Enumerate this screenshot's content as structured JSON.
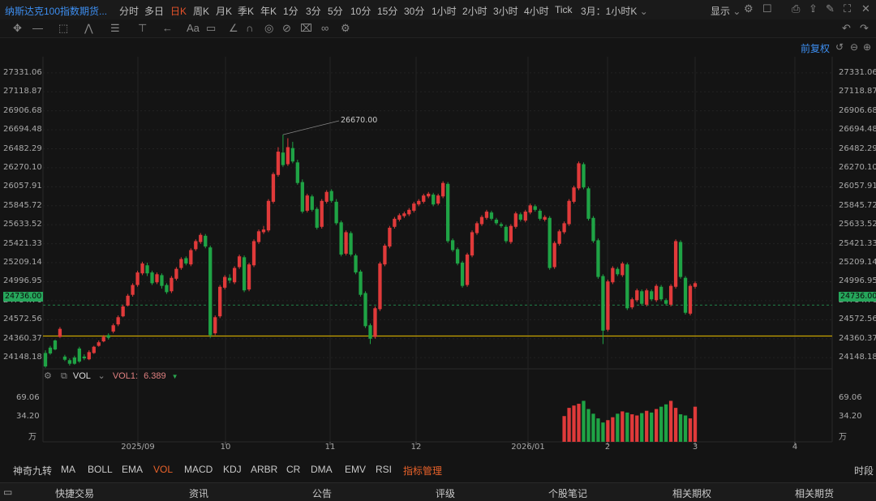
{
  "app": {
    "instrument_title": "纳斯达克100指数期货...",
    "timeframes": [
      "分时",
      "多日",
      "日K",
      "周K",
      "月K",
      "季K",
      "年K",
      "1分",
      "3分",
      "5分",
      "10分",
      "15分",
      "30分",
      "1小时",
      "2小时",
      "3小时",
      "4小时",
      "Tick"
    ],
    "active_timeframe": "日K",
    "contract_select": "3月：1小时K",
    "display_label": "显示",
    "adjust_label": "前复权"
  },
  "chart_data": {
    "type": "candlestick",
    "y_ticks": [
      "27331.06",
      "27118.87",
      "26906.68",
      "26694.48",
      "26482.29",
      "26270.10",
      "26057.91",
      "25845.72",
      "25633.52",
      "25421.33",
      "25209.14",
      "24996.95",
      "24784.76",
      "24572.56",
      "24360.37",
      "24148.18"
    ],
    "y_range": [
      24050,
      27420
    ],
    "x_ticks": [
      "2025/09",
      "10",
      "11",
      "12",
      "2026/01",
      "2",
      "3",
      "4"
    ],
    "current_price": "24736.00",
    "horizontal_line": 24390,
    "max_annotation": "26670.00",
    "candles": [
      [
        24200,
        24050,
        24230,
        24035
      ],
      [
        24260,
        24195,
        24280,
        24180
      ],
      [
        24340,
        24240,
        24350,
        24230
      ],
      [
        24380,
        24470,
        24490,
        24370
      ],
      [
        24160,
        24125,
        24180,
        24110
      ],
      [
        24120,
        24080,
        24140,
        24060
      ],
      [
        24150,
        24080,
        24170,
        24070
      ],
      [
        24250,
        24105,
        24270,
        24090
      ],
      [
        24160,
        24140,
        24185,
        24120
      ],
      [
        24130,
        24210,
        24230,
        24120
      ],
      [
        24200,
        24270,
        24280,
        24190
      ],
      [
        24280,
        24320,
        24340,
        24270
      ],
      [
        24330,
        24380,
        24400,
        24320
      ],
      [
        24400,
        24370,
        24420,
        24350
      ],
      [
        24440,
        24510,
        24530,
        24420
      ],
      [
        24520,
        24600,
        24620,
        24500
      ],
      [
        24610,
        24720,
        24740,
        24600
      ],
      [
        24730,
        24840,
        24860,
        24720
      ],
      [
        24850,
        24960,
        24980,
        24830
      ],
      [
        24960,
        25100,
        25120,
        24940
      ],
      [
        25090,
        25200,
        25220,
        25070
      ],
      [
        25180,
        25090,
        25210,
        25060
      ],
      [
        25100,
        24980,
        25120,
        24960
      ],
      [
        24990,
        25080,
        25100,
        24970
      ],
      [
        25070,
        24950,
        25090,
        24920
      ],
      [
        24960,
        24880,
        24980,
        24860
      ],
      [
        24890,
        25040,
        25060,
        24870
      ],
      [
        25030,
        25140,
        25160,
        25010
      ],
      [
        25150,
        25250,
        25270,
        25130
      ],
      [
        25260,
        25200,
        25280,
        25180
      ],
      [
        25190,
        25350,
        25370,
        25170
      ],
      [
        25360,
        25450,
        25470,
        25340
      ],
      [
        25440,
        25520,
        25540,
        25420
      ],
      [
        25510,
        25390,
        25530,
        25370
      ],
      [
        25380,
        24400,
        25400,
        24370
      ],
      [
        24420,
        24600,
        24620,
        24400
      ],
      [
        24610,
        24940,
        24960,
        24590
      ],
      [
        24930,
        25050,
        25070,
        24910
      ],
      [
        25040,
        25010,
        25080,
        24980
      ],
      [
        24990,
        25150,
        25170,
        24970
      ],
      [
        25160,
        25280,
        25300,
        25140
      ],
      [
        25270,
        24900,
        25290,
        24880
      ],
      [
        24910,
        25190,
        25210,
        24890
      ],
      [
        25180,
        25450,
        25470,
        25160
      ],
      [
        25440,
        25560,
        25580,
        25420
      ],
      [
        25550,
        25580,
        25620,
        25530
      ],
      [
        25570,
        25900,
        25920,
        25550
      ],
      [
        25890,
        26200,
        26220,
        25870
      ],
      [
        26190,
        26450,
        26500,
        26170
      ],
      [
        26440,
        26300,
        26640,
        26280
      ],
      [
        26310,
        26500,
        26600,
        26290
      ],
      [
        26490,
        26340,
        26560,
        26320
      ],
      [
        26330,
        26100,
        26360,
        26080
      ],
      [
        26110,
        25780,
        26140,
        25760
      ],
      [
        25790,
        25960,
        25980,
        25770
      ],
      [
        25950,
        25800,
        25970,
        25780
      ],
      [
        25810,
        25600,
        25830,
        25580
      ],
      [
        25610,
        25900,
        25920,
        25590
      ],
      [
        25890,
        26000,
        26020,
        25870
      ],
      [
        26010,
        25900,
        26030,
        25880
      ],
      [
        25890,
        25650,
        25920,
        25630
      ],
      [
        25660,
        25300,
        25680,
        25280
      ],
      [
        25310,
        25550,
        25570,
        25290
      ],
      [
        25540,
        25300,
        25560,
        25280
      ],
      [
        25290,
        25100,
        25310,
        25080
      ],
      [
        25110,
        24850,
        25130,
        24830
      ],
      [
        24870,
        24500,
        24890,
        24480
      ],
      [
        24510,
        24360,
        24530,
        24300
      ],
      [
        24380,
        24700,
        24720,
        24360
      ],
      [
        24690,
        25200,
        25220,
        24670
      ],
      [
        25190,
        25400,
        25420,
        25170
      ],
      [
        25390,
        25600,
        25620,
        25370
      ],
      [
        25610,
        25700,
        25720,
        25590
      ],
      [
        25690,
        25740,
        25760,
        25670
      ],
      [
        25730,
        25760,
        25780,
        25710
      ],
      [
        25750,
        25800,
        25820,
        25730
      ],
      [
        25790,
        25870,
        25890,
        25770
      ],
      [
        25860,
        25900,
        25920,
        25840
      ],
      [
        25890,
        25960,
        25980,
        25870
      ],
      [
        25950,
        25980,
        26000,
        25930
      ],
      [
        25970,
        25860,
        25990,
        25840
      ],
      [
        25870,
        25960,
        25980,
        25850
      ],
      [
        25950,
        26100,
        26120,
        25930
      ],
      [
        26090,
        25450,
        26110,
        25430
      ],
      [
        25460,
        25350,
        25480,
        25330
      ],
      [
        25360,
        25200,
        25380,
        25180
      ],
      [
        25210,
        24950,
        25230,
        24930
      ],
      [
        24960,
        25300,
        25320,
        24940
      ],
      [
        25290,
        25550,
        25570,
        25270
      ],
      [
        25540,
        25650,
        25670,
        25520
      ],
      [
        25640,
        25720,
        25740,
        25620
      ],
      [
        25710,
        25780,
        25800,
        25690
      ],
      [
        25770,
        25700,
        25790,
        25680
      ],
      [
        25690,
        25650,
        25710,
        25630
      ],
      [
        25640,
        25620,
        25660,
        25600
      ],
      [
        25610,
        25450,
        25630,
        25430
      ],
      [
        25440,
        25620,
        25640,
        25420
      ],
      [
        25610,
        25760,
        25780,
        25590
      ],
      [
        25750,
        25690,
        25770,
        25670
      ],
      [
        25680,
        25780,
        25800,
        25660
      ],
      [
        25770,
        25850,
        25870,
        25750
      ],
      [
        25840,
        25800,
        25860,
        25780
      ],
      [
        25790,
        25700,
        25810,
        25680
      ],
      [
        25690,
        25720,
        25740,
        25670
      ],
      [
        25710,
        25150,
        25730,
        25130
      ],
      [
        25160,
        25430,
        25450,
        25140
      ],
      [
        25420,
        25560,
        25580,
        25400
      ],
      [
        25550,
        25650,
        25670,
        25530
      ],
      [
        25640,
        25900,
        25920,
        25620
      ],
      [
        25890,
        26050,
        26070,
        25870
      ],
      [
        26040,
        26320,
        26340,
        26020
      ],
      [
        26310,
        26050,
        26330,
        26030
      ],
      [
        26040,
        25700,
        26060,
        25680
      ],
      [
        25710,
        25450,
        25730,
        25430
      ],
      [
        25460,
        25050,
        25480,
        25030
      ],
      [
        25060,
        24450,
        25080,
        24300
      ],
      [
        24460,
        25000,
        25020,
        24440
      ],
      [
        24990,
        25150,
        25170,
        24970
      ],
      [
        25140,
        25080,
        25160,
        25060
      ],
      [
        25070,
        25200,
        25220,
        25050
      ],
      [
        25190,
        24700,
        25210,
        24680
      ],
      [
        24710,
        24800,
        24820,
        24690
      ],
      [
        24790,
        24900,
        24920,
        24770
      ],
      [
        24890,
        24750,
        24910,
        24730
      ],
      [
        24740,
        24900,
        24920,
        24720
      ],
      [
        24890,
        24800,
        24910,
        24780
      ],
      [
        24790,
        24950,
        24970,
        24770
      ],
      [
        24940,
        24800,
        24960,
        24780
      ],
      [
        24790,
        24750,
        24810,
        24730
      ],
      [
        24740,
        24950,
        24970,
        24720
      ],
      [
        24940,
        25450,
        25470,
        24920
      ],
      [
        25440,
        25050,
        25460,
        25030
      ],
      [
        25040,
        24650,
        25060,
        24630
      ],
      [
        24640,
        24950,
        24970,
        24620
      ],
      [
        24940,
        24980,
        25000,
        24920
      ]
    ],
    "volume": {
      "ticks": [
        "69.06",
        "34.20",
        "万"
      ],
      "range": [
        0,
        90
      ],
      "values": [
        0,
        0,
        0,
        0,
        0,
        0,
        0,
        0,
        0,
        0,
        0,
        0,
        0,
        0,
        0,
        0,
        0,
        0,
        0,
        0,
        0,
        0,
        0,
        0,
        0,
        0,
        0,
        0,
        0,
        0,
        0,
        0,
        0,
        0,
        0,
        0,
        0,
        0,
        0,
        0,
        0,
        0,
        0,
        0,
        0,
        0,
        0,
        0,
        0,
        0,
        0,
        0,
        0,
        0,
        0,
        0,
        0,
        0,
        0,
        0,
        0,
        0,
        0,
        0,
        0,
        0,
        0,
        0,
        0,
        0,
        0,
        0,
        0,
        0,
        0,
        0,
        0,
        0,
        0,
        0,
        0,
        0,
        0,
        0,
        0,
        0,
        0,
        0,
        0,
        0,
        0,
        0,
        0,
        0,
        0,
        0,
        0,
        0,
        0,
        0,
        0,
        0,
        0,
        0,
        0,
        0,
        0,
        44,
        58,
        62,
        65,
        70,
        56,
        48,
        40,
        33,
        37,
        42,
        48,
        52,
        50,
        47,
        45,
        49,
        53,
        50,
        56,
        60,
        64,
        70,
        58,
        47,
        45,
        40,
        60
      ]
    },
    "vol_indicator": {
      "name": "VOL",
      "value_label": "VOL1:",
      "value": "6.389"
    }
  },
  "indicator_tabs": [
    "神奇九转",
    "MA",
    "BOLL",
    "EMA",
    "VOL",
    "MACD",
    "KDJ",
    "ARBR",
    "CR",
    "DMA",
    "EMV",
    "RSI",
    "指标管理"
  ],
  "active_indicator": "VOL",
  "right_tab": "时段",
  "footer": [
    "快捷交易",
    "资讯",
    "公告",
    "评级",
    "个股笔记",
    "相关期权",
    "相关期货"
  ],
  "colors": {
    "up": "#e03a3a",
    "down": "#1fa345",
    "accent": "#e8522a",
    "link": "#3d8ef0",
    "line": "#c8a400"
  }
}
